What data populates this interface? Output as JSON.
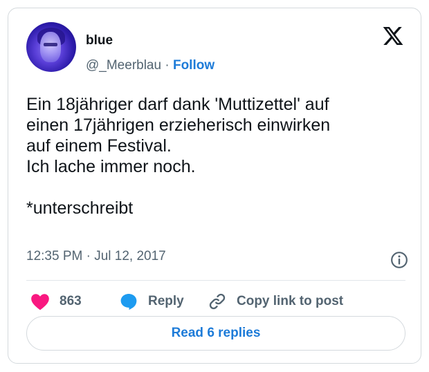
{
  "author": {
    "display_name": "blue",
    "handle": "@_Meerblau",
    "separator": "·",
    "follow_label": "Follow"
  },
  "tweet": {
    "text": "Ein 18jähriger darf dank 'Muttizettel' auf\neinen 17jährigen erzieherisch einwirken\nauf einem Festival.\nIch lache immer noch.\n\n*unterschreibt",
    "timestamp": "12:35 PM · Jul 12, 2017"
  },
  "actions": {
    "like_count": "863",
    "reply_label": "Reply",
    "copy_label": "Copy link to post"
  },
  "read_replies_label": "Read 6 replies",
  "icons": {
    "logo": "x-logo-icon",
    "like": "heart-icon",
    "reply": "speech-bubble-icon",
    "copy": "link-icon",
    "info": "info-icon"
  },
  "colors": {
    "accent": "#1d7bd8",
    "like": "#f91880",
    "reply": "#1d9bf0",
    "muted": "#536471",
    "text": "#0f1419"
  }
}
